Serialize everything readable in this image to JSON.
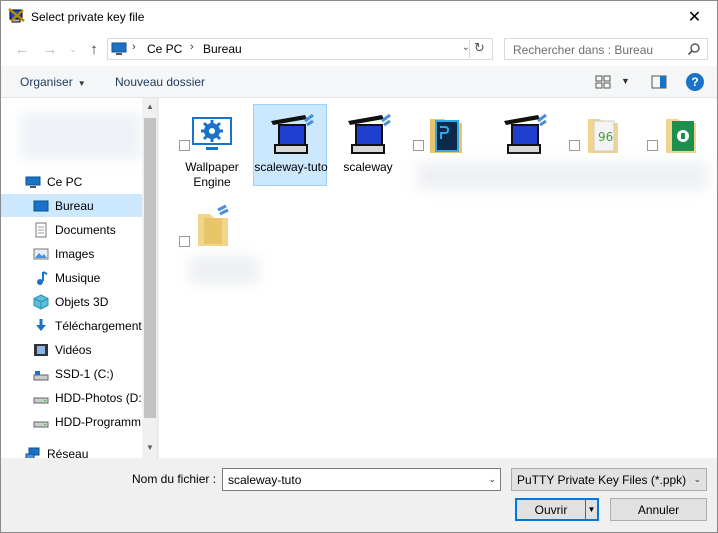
{
  "title": "Select private key file",
  "address": {
    "segments": [
      "Ce PC",
      "Bureau"
    ]
  },
  "search": {
    "placeholder": "Rechercher dans : Bureau"
  },
  "toolbar": {
    "organize": "Organiser",
    "new_folder": "Nouveau dossier",
    "help": "?"
  },
  "sidebar": {
    "items": [
      {
        "label": "Ce PC",
        "icon": "computer-icon"
      },
      {
        "label": "Bureau",
        "icon": "desktop-icon",
        "selected": true
      },
      {
        "label": "Documents",
        "icon": "documents-icon"
      },
      {
        "label": "Images",
        "icon": "images-icon"
      },
      {
        "label": "Musique",
        "icon": "music-icon"
      },
      {
        "label": "Objets 3D",
        "icon": "objects-3d-icon"
      },
      {
        "label": "Téléchargements",
        "icon": "downloads-icon"
      },
      {
        "label": "Vidéos",
        "icon": "videos-icon"
      },
      {
        "label": "SSD-1 (C:)",
        "icon": "drive-icon"
      },
      {
        "label": "HDD-Photos (D:",
        "icon": "drive-icon"
      },
      {
        "label": "HDD-Programm",
        "icon": "drive-icon"
      },
      {
        "label": "Réseau",
        "icon": "network-icon"
      }
    ]
  },
  "files": [
    {
      "label": "Wallpaper Engine",
      "icon": "gear-monitor-icon",
      "shortcut": true
    },
    {
      "label": "scaleway-tuto",
      "icon": "putty-key-icon",
      "selected": true
    },
    {
      "label": "scaleway",
      "icon": "putty-key-icon"
    },
    {
      "label": "",
      "icon": "photoshop-folder-icon",
      "shortcut": true
    },
    {
      "label": "",
      "icon": "putty-key-icon"
    },
    {
      "label": "",
      "icon": "folder-file-icon",
      "shortcut": true
    },
    {
      "label": "",
      "icon": "green-file-icon",
      "shortcut": true
    },
    {
      "label": "",
      "icon": "folder-icon",
      "shortcut": true
    }
  ],
  "bottom": {
    "filename_label": "Nom du fichier :",
    "filename_value": "scaleway-tuto",
    "filter": "PuTTY Private Key Files (*.ppk)",
    "open": "Ouvrir",
    "cancel": "Annuler"
  },
  "colors": {
    "selection": "#cce8ff",
    "accent": "#0078d7"
  }
}
